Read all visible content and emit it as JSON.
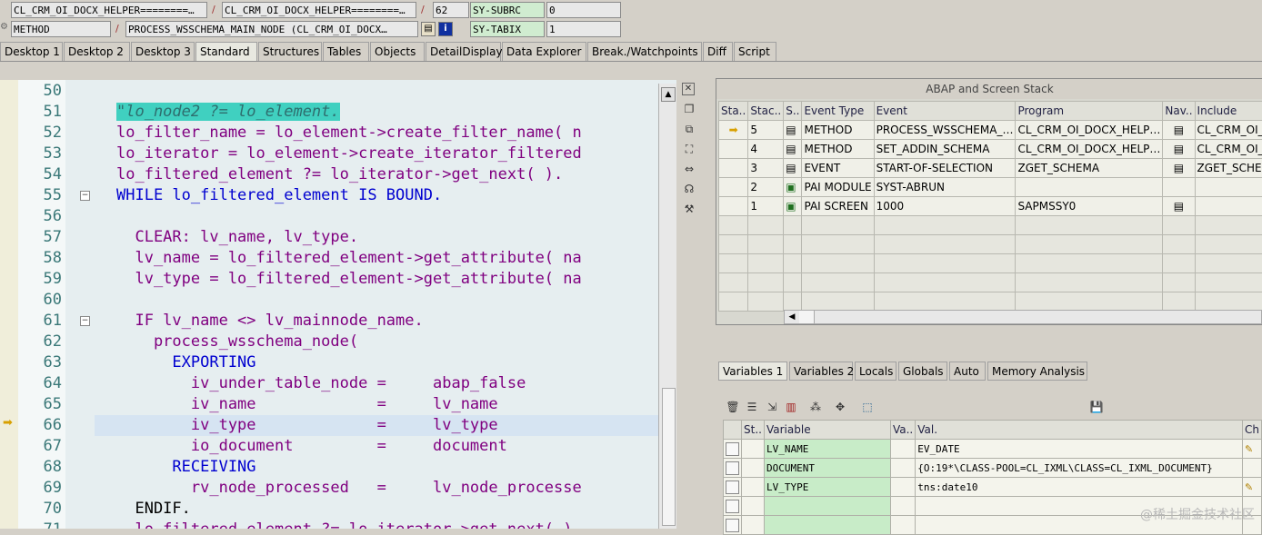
{
  "infobar": {
    "row1": {
      "field1": "CL_CRM_OI_DOCX_HELPER========…",
      "field2": "CL_CRM_OI_DOCX_HELPER========…",
      "line": "62",
      "var_name": "SY-SUBRC",
      "var_value": "0"
    },
    "row2": {
      "event_type": "METHOD",
      "event": "PROCESS_WSSCHEMA_MAIN_NODE (CL_CRM_OI_DOCX…",
      "var_name": "SY-TABIX",
      "var_value": "1"
    },
    "slash": "/"
  },
  "tabs": [
    "Desktop 1",
    "Desktop 2",
    "Desktop 3",
    "Standard",
    "Structures",
    "Tables",
    "Objects",
    "DetailDisplay",
    "Data Explorer",
    "Break./Watchpoints",
    "Diff",
    "Script"
  ],
  "editor": {
    "line_numbers": [
      "50",
      "51",
      "52",
      "53",
      "54",
      "55",
      "56",
      "57",
      "58",
      "59",
      "60",
      "61",
      "62",
      "63",
      "64",
      "65",
      "66",
      "67",
      "68",
      "69",
      "70",
      "71"
    ],
    "lines": [
      "",
      "\"lo_node2 ?= lo_element.",
      "lo_filter_name = lo_element->create_filter_name( n",
      "lo_iterator = lo_element->create_iterator_filtered",
      "lo_filtered_element ?= lo_iterator->get_next( ).",
      "WHILE lo_filtered_element IS BOUND.",
      "",
      "  CLEAR: lv_name, lv_type.",
      "  lv_name = lo_filtered_element->get_attribute( na",
      "  lv_type = lo_filtered_element->get_attribute( na",
      "",
      "  IF lv_name <> lv_mainnode_name.",
      "    process_wsschema_node(",
      "      EXPORTING",
      "        iv_under_table_node =     abap_false",
      "        iv_name             =     lv_name",
      "        iv_type             =     lv_type",
      "        io_document         =     document",
      "      RECEIVING",
      "        rv_node_processed   =     lv_node_processe",
      "  ENDIF.",
      "  lo_filtered_element ?= lo_iterator->get_next( )."
    ]
  },
  "stack": {
    "title": "ABAP and Screen Stack",
    "columns": [
      "Sta..",
      "Stac..",
      "S..",
      "Event Type",
      "Event",
      "Program",
      "Nav..",
      "Include"
    ],
    "rows": [
      {
        "level": "5",
        "type": "METHOD",
        "event": "PROCESS_WSSCHEMA_…",
        "program": "CL_CRM_OI_DOCX_HELP…",
        "include": "CL_CRM_OI_D"
      },
      {
        "level": "4",
        "type": "METHOD",
        "event": "SET_ADDIN_SCHEMA",
        "program": "CL_CRM_OI_DOCX_HELP…",
        "include": "CL_CRM_OI_D"
      },
      {
        "level": "3",
        "type": "EVENT",
        "event": "START-OF-SELECTION",
        "program": "ZGET_SCHEMA",
        "include": "ZGET_SCHEM"
      },
      {
        "level": "2",
        "type": "PAI MODULE",
        "event": "SYST-ABRUN",
        "program": "",
        "include": ""
      },
      {
        "level": "1",
        "type": "PAI SCREEN",
        "event": "1000",
        "program": "SAPMSSY0",
        "include": ""
      }
    ]
  },
  "var_tabs": [
    "Variables 1",
    "Variables 2",
    "Locals",
    "Globals",
    "Auto",
    "Memory Analysis"
  ],
  "variables": {
    "columns": [
      "St..",
      "Variable",
      "Va..",
      "Val.",
      "Ch"
    ],
    "rows": [
      {
        "name": "LV_NAME",
        "value": "EV_DATE"
      },
      {
        "name": "DOCUMENT",
        "value": "{O:19*\\CLASS-POOL=CL_IXML\\CLASS=CL_IXML_DOCUMENT}"
      },
      {
        "name": "LV_TYPE",
        "value": "tns:date10"
      }
    ]
  },
  "watermark": "@稀土掘金技术社区"
}
